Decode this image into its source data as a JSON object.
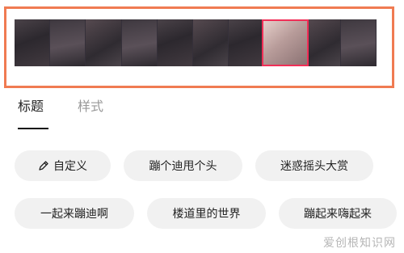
{
  "tabs": [
    {
      "label": "标题",
      "active": true
    },
    {
      "label": "样式",
      "active": false
    }
  ],
  "filmstrip": {
    "frame_count": 10,
    "selected_frame": 8
  },
  "chips": {
    "row1": [
      {
        "label": "自定义",
        "icon": "pencil-icon"
      },
      {
        "label": "蹦个迪甩个头"
      },
      {
        "label": "迷惑摇头大赏"
      }
    ],
    "row2": [
      {
        "label": "一起来蹦迪啊"
      },
      {
        "label": "楼道里的世界"
      },
      {
        "label": "蹦起来嗨起来"
      }
    ]
  },
  "watermark": "爱创根知识网",
  "colors": {
    "highlight_border": "#f07b52",
    "selected_frame_border": "#f02f57",
    "chip_bg": "#f1f1f1"
  }
}
